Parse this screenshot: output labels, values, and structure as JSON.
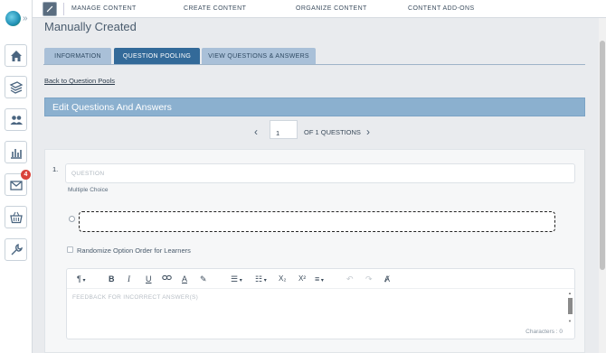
{
  "topnav": {
    "links": [
      "MANAGE CONTENT",
      "CREATE CONTENT",
      "ORGANIZE CONTENT",
      "CONTENT ADD-ONS"
    ]
  },
  "sidebar": {
    "items": [
      {
        "icon": "home-icon"
      },
      {
        "icon": "courses-icon"
      },
      {
        "icon": "users-icon"
      },
      {
        "icon": "reports-icon"
      },
      {
        "icon": "messages-icon",
        "badge": "4"
      },
      {
        "icon": "store-icon"
      },
      {
        "icon": "tools-icon"
      }
    ]
  },
  "page": {
    "title": "Manually Created",
    "tabs": [
      "INFORMATION",
      "QUESTION POOLING",
      "VIEW QUESTIONS & ANSWERS"
    ],
    "active_tab": "QUESTION POOLING",
    "back_link": "Back to Question Pools",
    "section_title": "Edit Questions And Answers"
  },
  "pager": {
    "current": "1",
    "of_label": "OF 1 QUESTIONS"
  },
  "question": {
    "number": "1.",
    "placeholder": "QUESTION",
    "type": "Multiple Choice",
    "randomize_label": "Randomize Option Order for Learners",
    "feedback_placeholder": "FEEDBACK FOR INCORRECT ANSWER(S)",
    "characters_label": "Characters : 0"
  },
  "toolbar": {
    "paragraph": "¶",
    "bold": "B",
    "italic": "I",
    "underline": "U",
    "link": "🔗",
    "font_color": "A",
    "highlight": "✎",
    "ordered_list": "☰",
    "bullet_list": "☷",
    "subscript": "X₂",
    "superscript": "X²",
    "align": "≡",
    "undo": "↶",
    "redo": "↷",
    "clear": "Ⱥ"
  },
  "colors": {
    "active_tab": "#336a99",
    "inactive_tab": "#a9c0d8",
    "section_bar": "#8bb0cf",
    "badge": "#d9433b"
  }
}
